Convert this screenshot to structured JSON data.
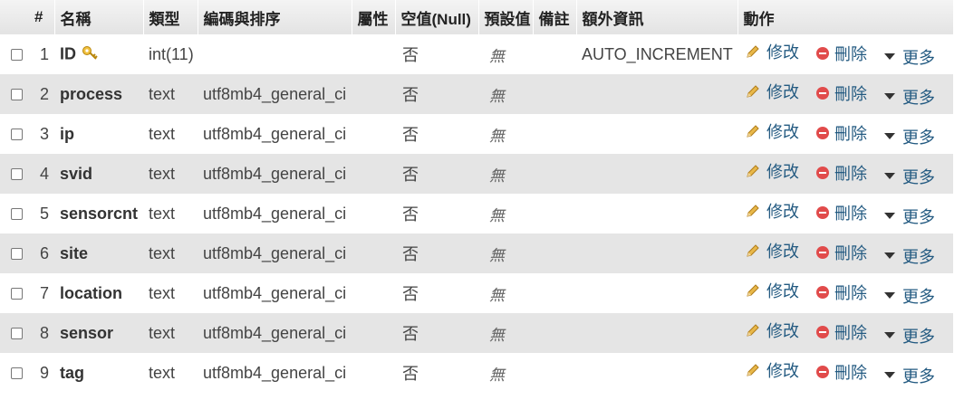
{
  "headers": {
    "num": "#",
    "name": "名稱",
    "type": "類型",
    "collation": "編碼與排序",
    "attributes": "屬性",
    "null": "空值(Null)",
    "default": "預設值",
    "comments": "備註",
    "extra": "額外資訊",
    "action": "動作"
  },
  "actions": {
    "edit": "修改",
    "drop": "刪除",
    "more": "更多"
  },
  "rows": [
    {
      "num": "1",
      "name": "ID",
      "type": "int(11)",
      "collation": "",
      "attributes": "",
      "null": "否",
      "default": "無",
      "comments": "",
      "extra": "AUTO_INCREMENT"
    },
    {
      "num": "2",
      "name": "process",
      "type": "text",
      "collation": "utf8mb4_general_ci",
      "attributes": "",
      "null": "否",
      "default": "無",
      "comments": "",
      "extra": ""
    },
    {
      "num": "3",
      "name": "ip",
      "type": "text",
      "collation": "utf8mb4_general_ci",
      "attributes": "",
      "null": "否",
      "default": "無",
      "comments": "",
      "extra": ""
    },
    {
      "num": "4",
      "name": "svid",
      "type": "text",
      "collation": "utf8mb4_general_ci",
      "attributes": "",
      "null": "否",
      "default": "無",
      "comments": "",
      "extra": ""
    },
    {
      "num": "5",
      "name": "sensorcnt",
      "type": "text",
      "collation": "utf8mb4_general_ci",
      "attributes": "",
      "null": "否",
      "default": "無",
      "comments": "",
      "extra": ""
    },
    {
      "num": "6",
      "name": "site",
      "type": "text",
      "collation": "utf8mb4_general_ci",
      "attributes": "",
      "null": "否",
      "default": "無",
      "comments": "",
      "extra": ""
    },
    {
      "num": "7",
      "name": "location",
      "type": "text",
      "collation": "utf8mb4_general_ci",
      "attributes": "",
      "null": "否",
      "default": "無",
      "comments": "",
      "extra": ""
    },
    {
      "num": "8",
      "name": "sensor",
      "type": "text",
      "collation": "utf8mb4_general_ci",
      "attributes": "",
      "null": "否",
      "default": "無",
      "comments": "",
      "extra": ""
    },
    {
      "num": "9",
      "name": "tag",
      "type": "text",
      "collation": "utf8mb4_general_ci",
      "attributes": "",
      "null": "否",
      "default": "無",
      "comments": "",
      "extra": ""
    }
  ],
  "colors": {
    "row_alt": "#e5e5e5",
    "link": "#235a81",
    "drop_icon": "#e14b4b"
  },
  "icons": {
    "primary_key": "key-icon",
    "edit": "pencil-icon",
    "drop": "drop-icon",
    "more": "dropdown-triangle-icon"
  }
}
